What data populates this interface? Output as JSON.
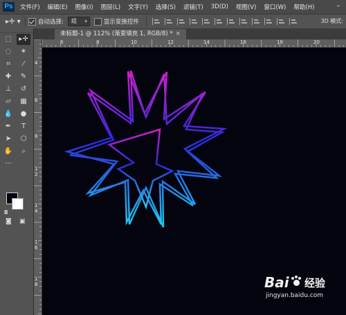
{
  "menubar": {
    "logo": "Ps",
    "items": [
      "文件(F)",
      "编辑(E)",
      "图像(I)",
      "图层(L)",
      "文字(Y)",
      "选择(S)",
      "滤镜(T)",
      "3D(D)",
      "视图(V)",
      "窗口(W)",
      "帮助(H)"
    ],
    "minimize_glyph": "–"
  },
  "options": {
    "tool_glyph": "▸✛ ▾",
    "auto_select_label": "自动选择:",
    "auto_select_checked": true,
    "auto_select_value": "组",
    "transform_controls_label": "显示变换控件",
    "transform_controls_checked": false,
    "mode3d_label": "3D 模式:"
  },
  "document": {
    "tab_title": "未标题-1 @ 112% (渐变填充 1, RGB/8) *",
    "close_glyph": "×"
  },
  "rulers": {
    "top": [
      "6",
      "8",
      "10",
      "12",
      "14",
      "16",
      "18",
      "20"
    ],
    "left": [
      "4",
      "6",
      "8",
      "1",
      "2",
      "1",
      "4",
      "1",
      "6",
      "1",
      "8"
    ]
  },
  "colors": {
    "foreground": "#05050f",
    "background": "#ffffff",
    "canvas": "#04040f",
    "gradient_top": "#d020c8",
    "gradient_mid": "#2a2ad8",
    "gradient_bottom": "#20c8f0"
  },
  "watermark": {
    "brand": "Bai",
    "brand_cn": "经验",
    "url": "jingyan.baidu.com"
  }
}
